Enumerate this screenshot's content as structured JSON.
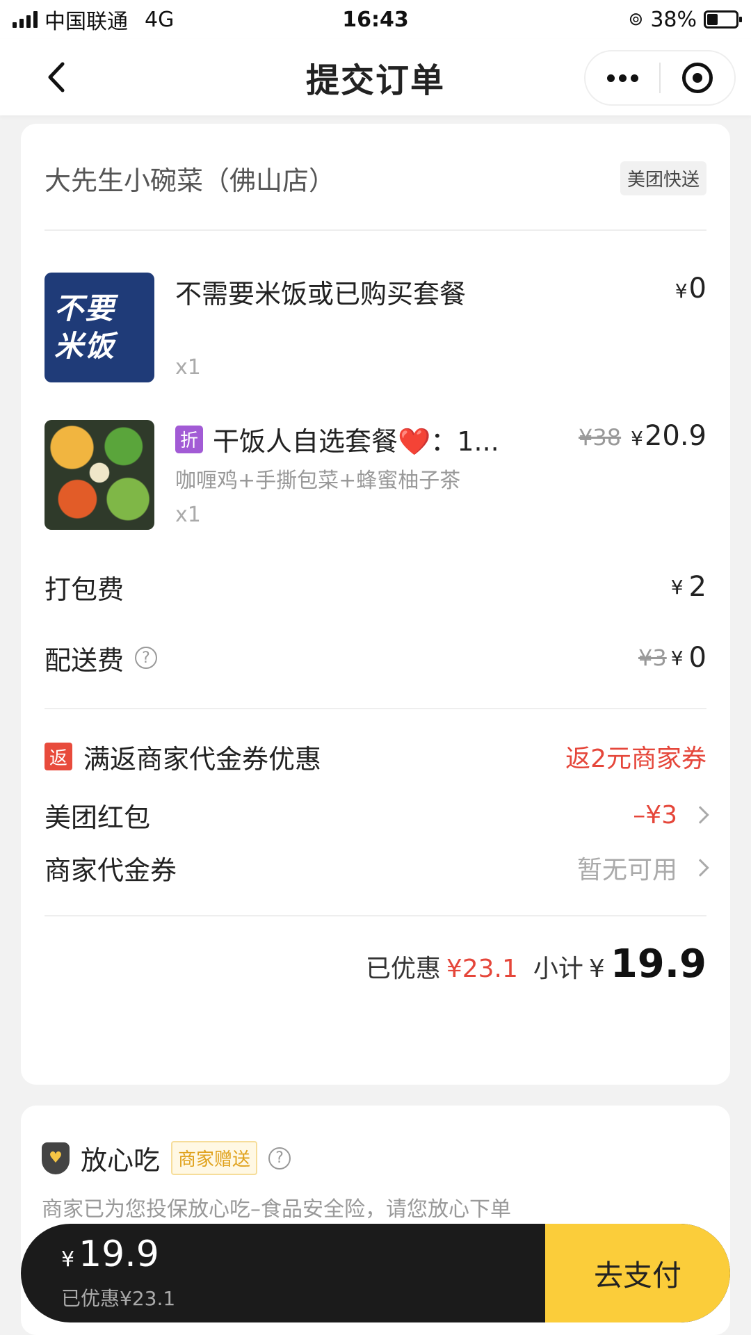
{
  "status_bar": {
    "carrier": "中国联通",
    "network": "4G",
    "time": "16:43",
    "battery_percent": "38%",
    "battery_level": 0.38
  },
  "nav": {
    "title": "提交订单",
    "back_icon": "chevron-left-icon",
    "more_icon": "more-dots-icon",
    "close_icon": "target-circle-icon"
  },
  "order": {
    "shop_name": "大先生小碗菜（佛山店）",
    "delivery_tag": "美团快送",
    "items": [
      {
        "thumb_line1": "不要",
        "thumb_line2": "米饭",
        "name": "不需要米饭或已购买套餐",
        "qty": "x1",
        "price_symbol": "¥",
        "price": "0"
      },
      {
        "badge": "折",
        "name": "干饭人自选套餐❤️：1...",
        "desc": "咖喱鸡+手撕包菜+蜂蜜柚子茶",
        "qty": "x1",
        "orig_price": "¥38",
        "price_symbol": "¥",
        "price": "20.9"
      }
    ],
    "packing_fee": {
      "label": "打包费",
      "symbol": "¥",
      "value": "2"
    },
    "delivery_fee": {
      "label": "配送费",
      "help": "?",
      "orig": "¥3",
      "symbol": "¥",
      "value": "0"
    },
    "return_promo": {
      "badge": "返",
      "label": "满返商家代金券优惠",
      "value": "返2元商家券"
    },
    "red_packet": {
      "label": "美团红包",
      "value": "–¥3"
    },
    "voucher": {
      "label": "商家代金券",
      "value": "暂无可用"
    },
    "subtotal": {
      "saved_label": "已优惠",
      "saved_value": "¥23.1",
      "subtotal_label": "小计",
      "symbol": "¥",
      "value": "19.9"
    }
  },
  "safe_eat": {
    "title": "放心吃",
    "gift_tag": "商家赠送",
    "help": "?",
    "desc": "商家已为您投保放心吃–食品安全险，请您放心下单"
  },
  "pay_bar": {
    "symbol": "¥",
    "amount": "19.9",
    "saved": "已优惠¥23.1",
    "button": "去支付"
  },
  "colors": {
    "accent_red": "#e5463a",
    "pay_yellow": "#fbcd3a",
    "discount_purple": "#a25bd5"
  }
}
